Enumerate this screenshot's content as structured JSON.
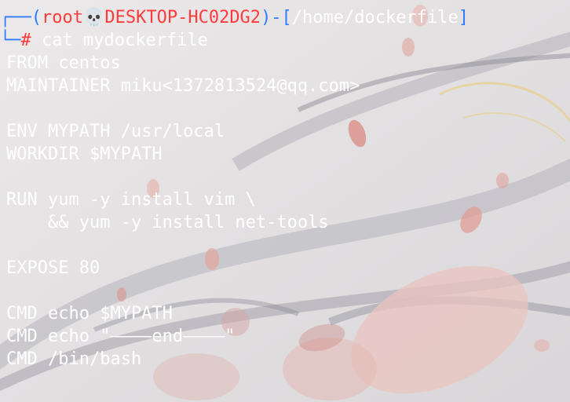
{
  "terminal": {
    "prompt": {
      "user": "root",
      "skull": "💀",
      "host": "DESKTOP-HC02DG2",
      "path": "/home/dockerfile",
      "symbol": "#",
      "command": "cat mydockerfile"
    },
    "output_lines": [
      "FROM centos",
      "MAINTAINER miku<1372813524@qq.com>",
      "",
      "ENV MYPATH /usr/local",
      "WORKDIR $MYPATH",
      "",
      "RUN yum -y install vim \\",
      "    && yum -y install net-tools",
      "",
      "EXPOSE 80",
      "",
      "CMD echo $MYPATH",
      "CMD echo \"————end————\"",
      "CMD /bin/bash"
    ]
  },
  "colors": {
    "prompt_blue": "#2f7bff",
    "prompt_red": "#ff3b3b",
    "text": "#ffffff",
    "background": "#e4e1e3"
  }
}
